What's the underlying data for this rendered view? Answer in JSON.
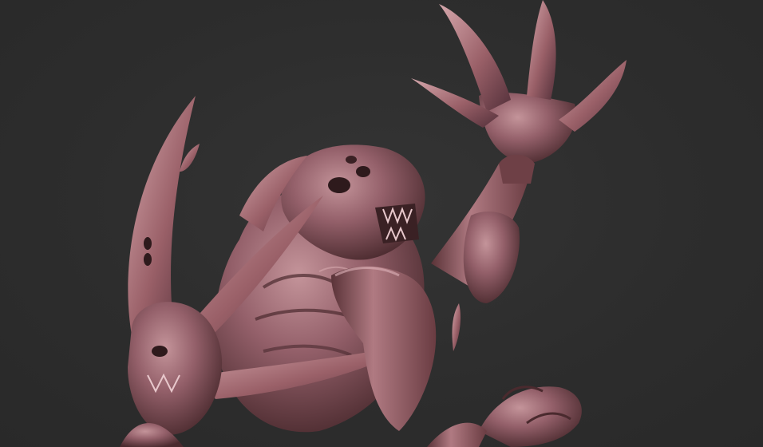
{
  "scene": {
    "subject": "sculpted-creature-model",
    "background_color": "#2d2d2d",
    "material_color": "#8c5a5e",
    "material_highlight": "#c99aa0",
    "material_shadow": "#3e2426"
  }
}
